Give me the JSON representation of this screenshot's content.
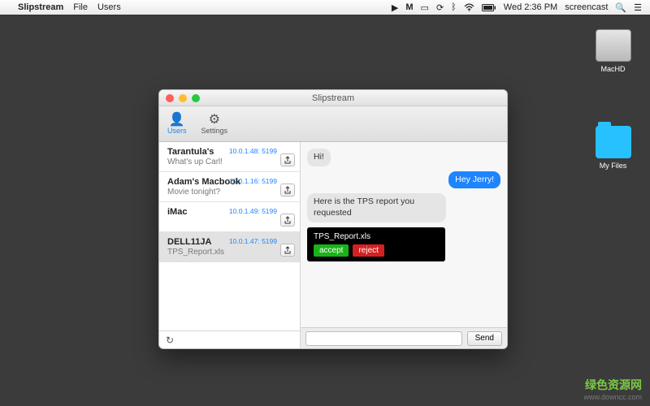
{
  "menubar": {
    "app": "Slipstream",
    "items": [
      "File",
      "Users"
    ],
    "right": {
      "datetime": "Wed 2:36 PM",
      "user": "screencast"
    }
  },
  "desktop": {
    "drive": "MacHD",
    "folder": "My Files"
  },
  "window": {
    "title": "Slipstream",
    "toolbar": {
      "users": "Users",
      "settings": "Settings"
    },
    "users": [
      {
        "name": "Tarantula's",
        "sub": "What's up Carl!",
        "addr": "10.0.1.48: 5199"
      },
      {
        "name": "Adam's Macbook",
        "sub": "Movie tonight?",
        "addr": "10.0.1.16: 5199"
      },
      {
        "name": "iMac",
        "sub": "",
        "addr": "10.0.1.49: 5199"
      },
      {
        "name": "DELL11JA",
        "sub": "TPS_Report.xls",
        "addr": "10.0.1.47: 5199"
      }
    ],
    "selected_user_index": 3,
    "chat": {
      "messages": [
        {
          "dir": "in",
          "text": "Hi!"
        },
        {
          "dir": "out",
          "text": "Hey Jerry!"
        },
        {
          "dir": "in",
          "text": "Here is the TPS report you requested"
        }
      ],
      "file": {
        "name": "TPS_Report.xls",
        "accept": "accept",
        "reject": "reject"
      },
      "send": "Send",
      "input_value": ""
    }
  },
  "watermark": {
    "cn": "绿色资源网",
    "url": "www.downcc.com"
  }
}
